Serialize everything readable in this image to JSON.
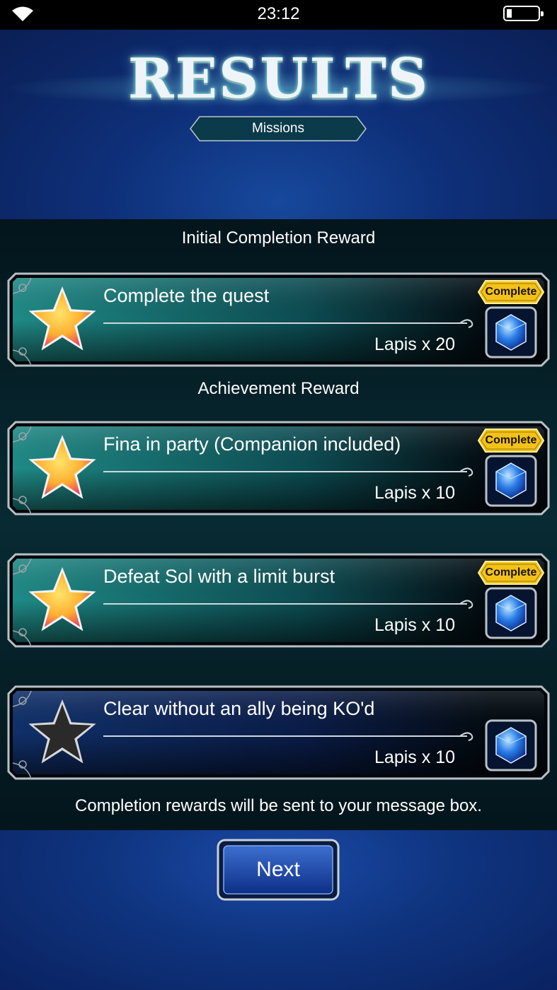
{
  "status_bar": {
    "time": "23:12",
    "icons": [
      "wifi-icon",
      "battery-icon"
    ]
  },
  "header": {
    "title": "RESULTS",
    "subtitle": "Missions"
  },
  "sections": {
    "initial_label": "Initial Completion Reward",
    "achievement_label": "Achievement Reward"
  },
  "missions": [
    {
      "name": "Complete the quest",
      "reward": "Lapis x 20",
      "badge": "Complete",
      "completed": true
    },
    {
      "name": "Fina in party (Companion included)",
      "reward": "Lapis x 10",
      "badge": "Complete",
      "completed": true
    },
    {
      "name": "Defeat Sol with a limit burst",
      "reward": "Lapis x 10",
      "badge": "Complete",
      "completed": true
    },
    {
      "name": "Clear without an ally being KO'd",
      "reward": "Lapis x 10",
      "badge": "",
      "completed": false
    }
  ],
  "footer_note": "Completion rewards will be sent to your message box.",
  "next_button": {
    "label": "Next"
  },
  "colors": {
    "teal_accent": "#1d7f7f",
    "badge_gold": "#f2c21a",
    "gem_blue": "#2a7de8"
  }
}
